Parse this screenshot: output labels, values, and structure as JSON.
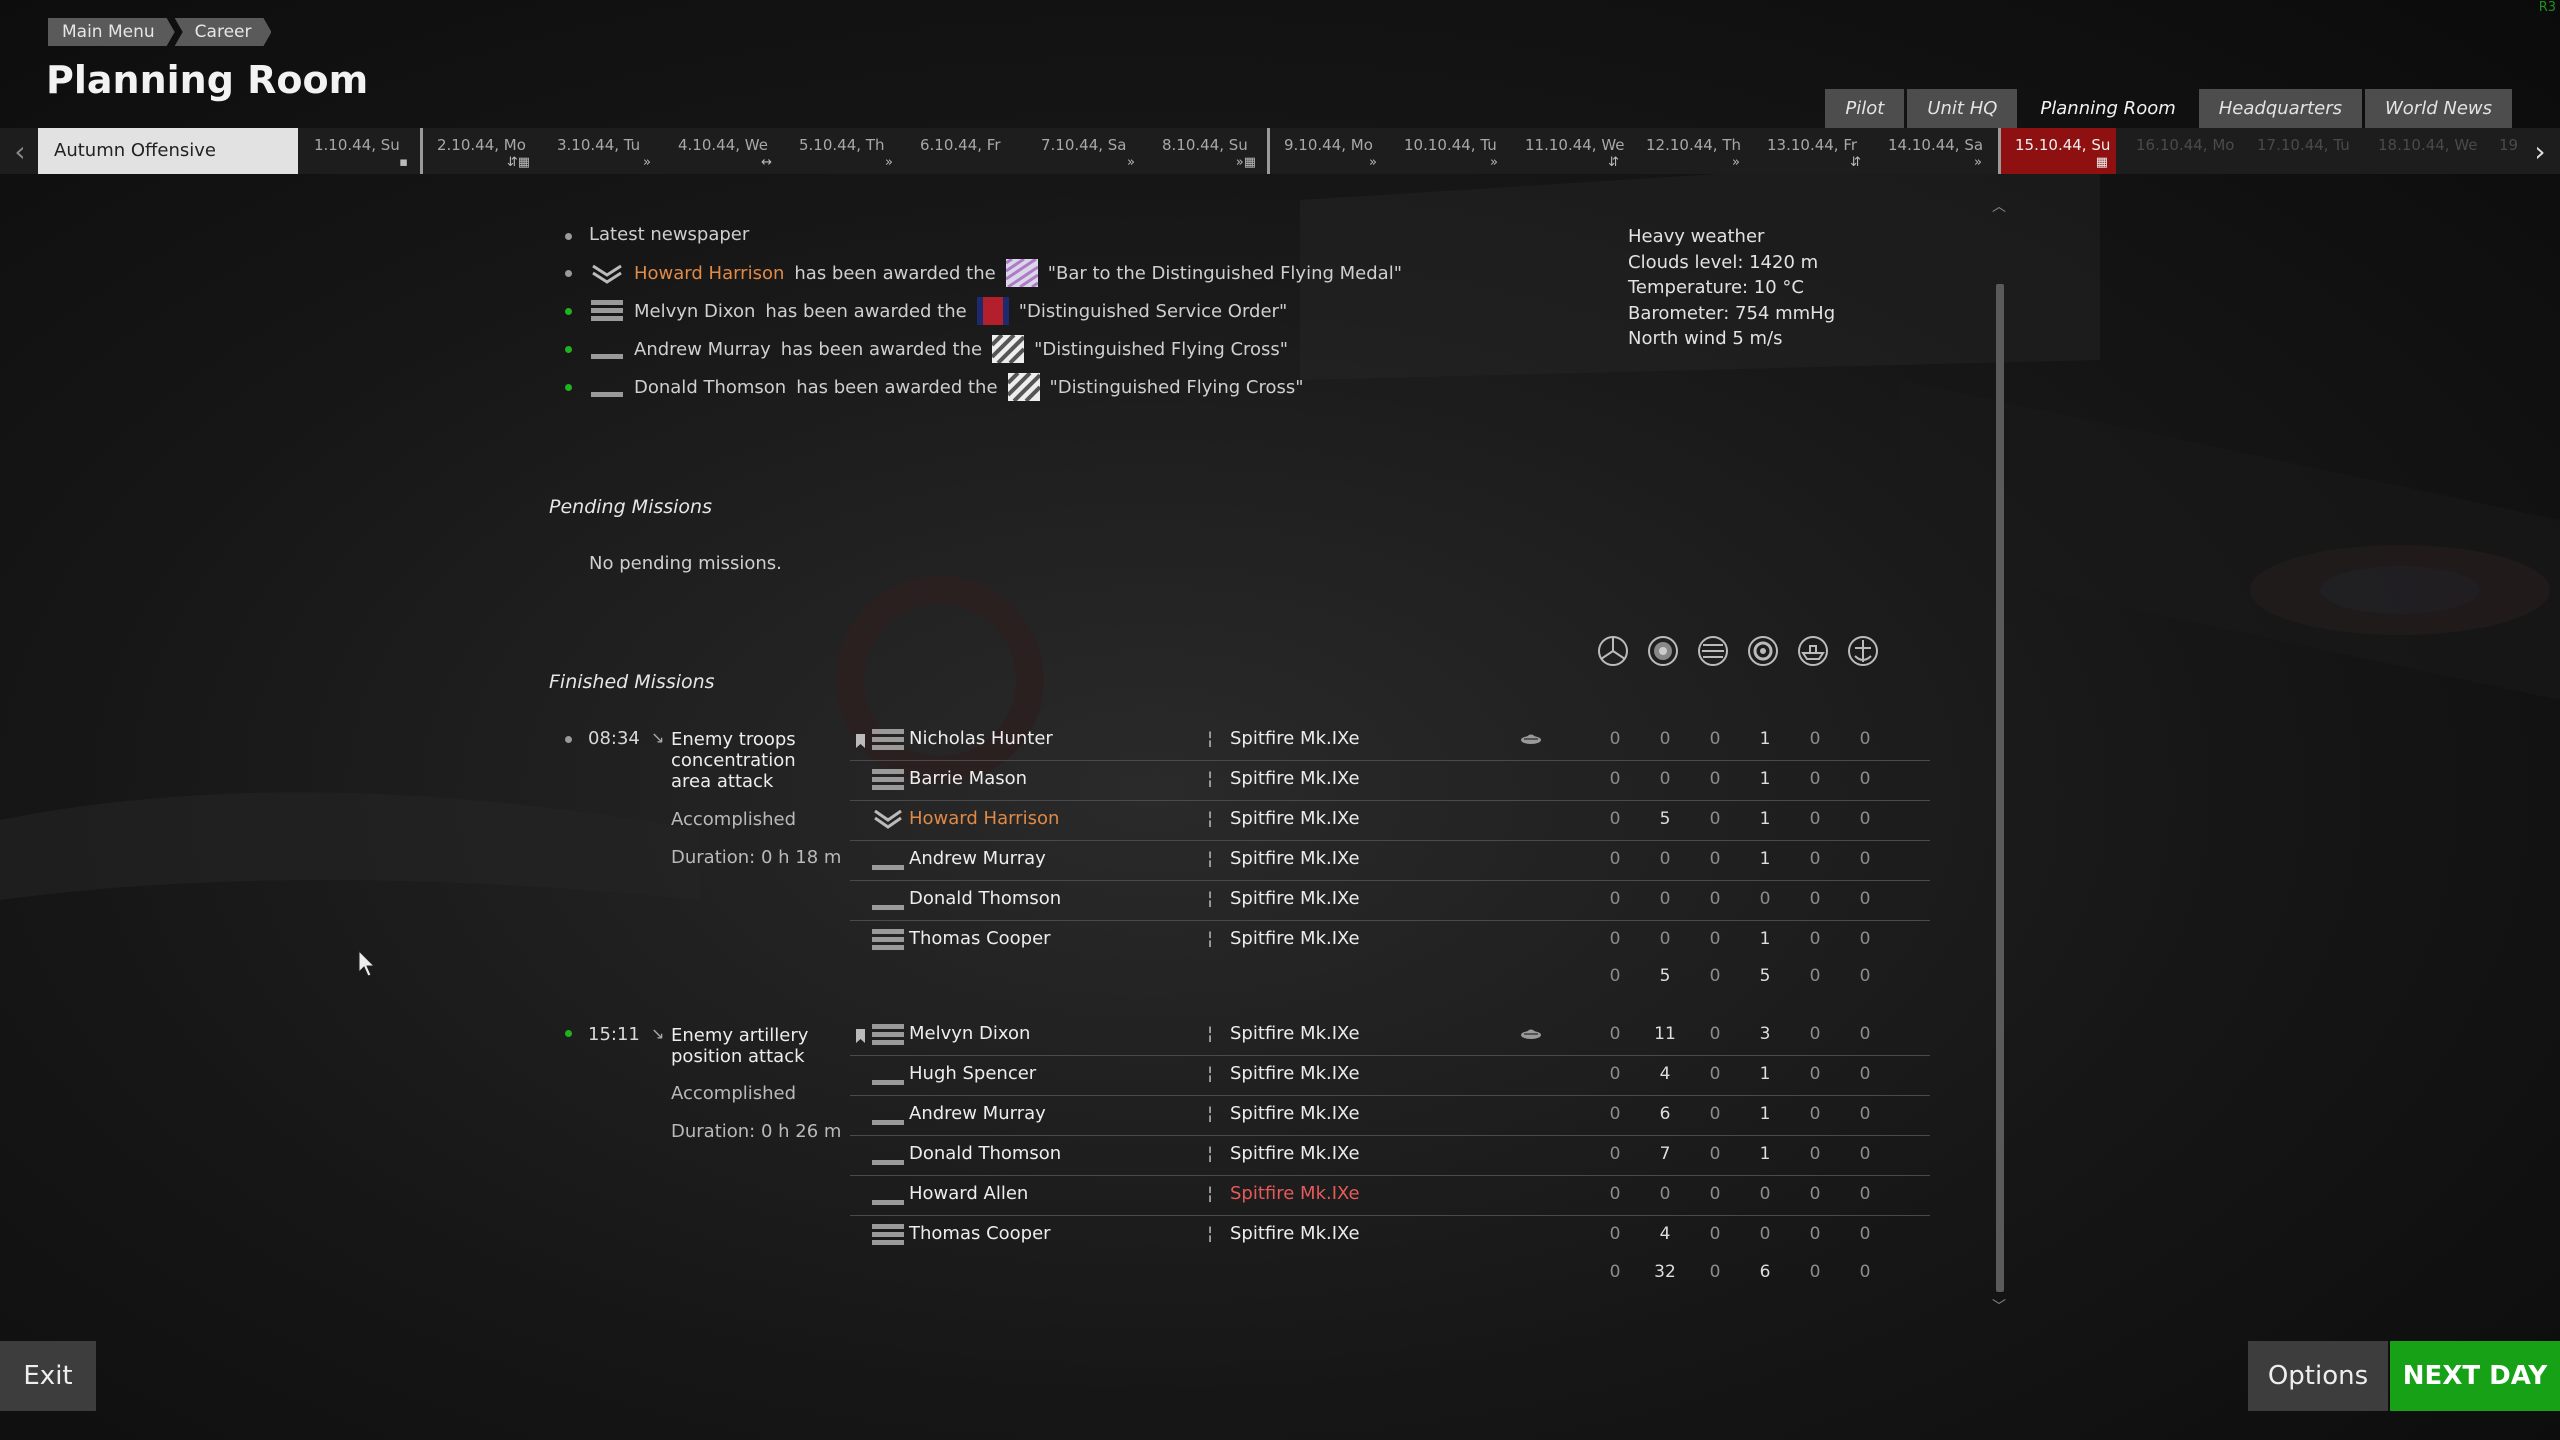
{
  "breadcrumb": [
    "Main Menu",
    "Career"
  ],
  "page_title": "Planning Room",
  "nav_tabs": [
    "Pilot",
    "Unit HQ",
    "Planning Room",
    "Headquarters",
    "World News"
  ],
  "active_tab": "Planning Room",
  "campaign_name": "Autumn Offensive",
  "timeline_days": [
    "1.10.44, Su",
    "2.10.44, Mo",
    "3.10.44, Tu",
    "4.10.44, We",
    "5.10.44, Th",
    "6.10.44, Fr",
    "7.10.44, Sa",
    "8.10.44, Su",
    "9.10.44, Mo",
    "10.10.44, Tu",
    "11.10.44, We",
    "12.10.44, Th",
    "13.10.44, Fr",
    "14.10.44, Sa",
    "15.10.44, Su",
    "16.10.44, Mo",
    "17.10.44, Tu",
    "18.10.44, We",
    "19"
  ],
  "current_day": "15.10.44, Su",
  "news": {
    "header": "Latest newspaper",
    "awarded_text": "has been awarded the",
    "items": [
      {
        "name": "Howard Harrison",
        "award": "\"Bar to the Distinguished Flying Medal\""
      },
      {
        "name": "Melvyn Dixon",
        "award": "\"Distinguished Service Order\""
      },
      {
        "name": "Andrew Murray",
        "award": "\"Distinguished Flying Cross\""
      },
      {
        "name": "Donald Thomson",
        "award": "\"Distinguished Flying Cross\""
      }
    ]
  },
  "weather": {
    "line1": "Heavy weather",
    "line2": "Clouds level: 1420 m",
    "line3": "Temperature: 10 °C",
    "line4": "Barometer: 754 mmHg",
    "line5": "North wind 5 m/s"
  },
  "pending": {
    "title": "Pending Missions",
    "empty_text": "No pending missions."
  },
  "finished_title": "Finished Missions",
  "missions": [
    {
      "time": "08:34",
      "title": "Enemy troops concentration area attack",
      "status": "Accomplished",
      "duration": "Duration: 0 h 18 m",
      "pilots": [
        {
          "name": "Nicholas Hunter",
          "plane": "Spitfire Mk.IXe",
          "stats": [
            0,
            0,
            0,
            1,
            0,
            0
          ]
        },
        {
          "name": "Barrie Mason",
          "plane": "Spitfire Mk.IXe",
          "stats": [
            0,
            0,
            0,
            1,
            0,
            0
          ]
        },
        {
          "name": "Howard Harrison",
          "plane": "Spitfire Mk.IXe",
          "stats": [
            0,
            5,
            0,
            1,
            0,
            0
          ]
        },
        {
          "name": "Andrew Murray",
          "plane": "Spitfire Mk.IXe",
          "stats": [
            0,
            0,
            0,
            1,
            0,
            0
          ]
        },
        {
          "name": "Donald Thomson",
          "plane": "Spitfire Mk.IXe",
          "stats": [
            0,
            0,
            0,
            0,
            0,
            0
          ]
        },
        {
          "name": "Thomas Cooper",
          "plane": "Spitfire Mk.IXe",
          "stats": [
            0,
            0,
            0,
            1,
            0,
            0
          ]
        }
      ],
      "totals": [
        0,
        5,
        0,
        5,
        0,
        0
      ]
    },
    {
      "time": "15:11",
      "title": "Enemy artillery position attack",
      "status": "Accomplished",
      "duration": "Duration: 0 h 26 m",
      "pilots": [
        {
          "name": "Melvyn Dixon",
          "plane": "Spitfire Mk.IXe",
          "stats": [
            0,
            11,
            0,
            3,
            0,
            0
          ]
        },
        {
          "name": "Hugh Spencer",
          "plane": "Spitfire Mk.IXe",
          "stats": [
            0,
            4,
            0,
            1,
            0,
            0
          ]
        },
        {
          "name": "Andrew Murray",
          "plane": "Spitfire Mk.IXe",
          "stats": [
            0,
            6,
            0,
            1,
            0,
            0
          ]
        },
        {
          "name": "Donald Thomson",
          "plane": "Spitfire Mk.IXe",
          "stats": [
            0,
            7,
            0,
            1,
            0,
            0
          ]
        },
        {
          "name": "Howard Allen",
          "plane": "Spitfire Mk.IXe",
          "stats": [
            0,
            0,
            0,
            0,
            0,
            0
          ]
        },
        {
          "name": "Thomas Cooper",
          "plane": "Spitfire Mk.IXe",
          "stats": [
            0,
            4,
            0,
            0,
            0,
            0
          ]
        }
      ],
      "totals": [
        0,
        32,
        0,
        6,
        0,
        0
      ]
    }
  ],
  "buttons": {
    "exit": "Exit",
    "options": "Options",
    "next_day": "NEXT DAY"
  },
  "corner_label": "R3",
  "colors": {
    "accent_red": "#8f1010",
    "next_day_green": "#17a117",
    "highlight_orange": "#e08a48",
    "lost_red": "#e55a5a"
  }
}
